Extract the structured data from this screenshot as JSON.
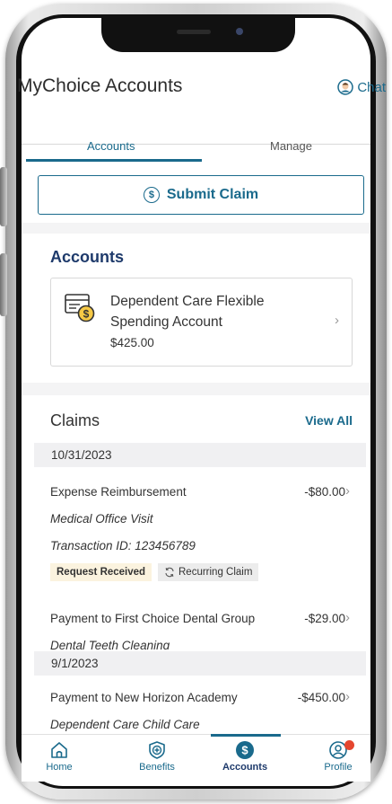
{
  "header": {
    "title": "MyChoice Accounts",
    "chat_label": "Chat"
  },
  "tabs": [
    {
      "label": "Accounts",
      "active": true
    },
    {
      "label": "Manage",
      "active": false
    }
  ],
  "submit_claim": {
    "label": "Submit Claim",
    "icon": "dollar-circle-icon"
  },
  "accounts": {
    "heading": "Accounts",
    "items": [
      {
        "name": "Dependent Care Flexible Spending Account",
        "balance": "$425.00",
        "icon": "card-dollar-icon"
      }
    ]
  },
  "claims": {
    "heading": "Claims",
    "view_all": "View All",
    "groups": [
      {
        "date": "10/31/2023",
        "items": [
          {
            "title": "Expense Reimbursement",
            "amount": "-$80.00",
            "description": "Medical Office Visit",
            "transaction": "Transaction ID: 123456789",
            "status": "Request Received",
            "recurring": "Recurring Claim"
          },
          {
            "title": "Payment to First Choice Dental Group",
            "amount": "-$29.00",
            "description": "Dental Teeth Cleaning"
          }
        ]
      },
      {
        "date": "9/1/2023",
        "items": [
          {
            "title": "Payment to New Horizon Academy",
            "amount": "-$450.00",
            "description": "Dependent Care Child Care"
          }
        ]
      }
    ]
  },
  "bottom_nav": [
    {
      "label": "Home",
      "icon": "home-icon"
    },
    {
      "label": "Benefits",
      "icon": "shield-plus-icon"
    },
    {
      "label": "Accounts",
      "icon": "dollar-circle-icon",
      "active": true
    },
    {
      "label": "Profile",
      "icon": "profile-icon",
      "has_notification": true
    }
  ],
  "colors": {
    "accent": "#1a6a8c",
    "heading_navy": "#1e3a6b",
    "status_badge_bg": "#fbf3df",
    "notification": "#e5462f"
  }
}
